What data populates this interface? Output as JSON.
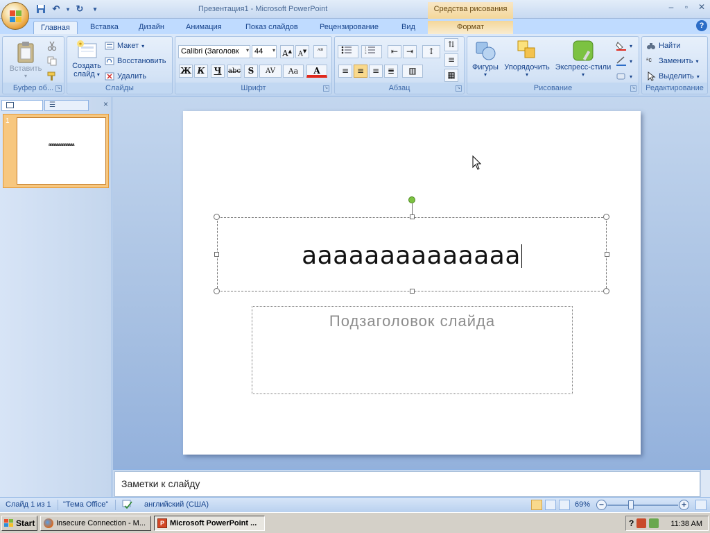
{
  "window": {
    "title": "Презентация1 - Microsoft PowerPoint",
    "context_tab_title": "Средства рисования"
  },
  "tabs": [
    {
      "label": "Главная",
      "active": true
    },
    {
      "label": "Вставка"
    },
    {
      "label": "Дизайн"
    },
    {
      "label": "Анимация"
    },
    {
      "label": "Показ слайдов"
    },
    {
      "label": "Рецензирование"
    },
    {
      "label": "Вид"
    },
    {
      "label": "Формат",
      "context": true
    }
  ],
  "ribbon": {
    "clipboard": {
      "label": "Буфер об...",
      "paste": "Вставить"
    },
    "slides": {
      "label": "Слайды",
      "new_slide_line1": "Создать",
      "new_slide_line2": "слайд",
      "layout": "Макет",
      "reset": "Восстановить",
      "delete": "Удалить"
    },
    "font": {
      "label": "Шрифт",
      "font_name": "Calibri (Заголовк",
      "font_size": "44",
      "bold": "Ж",
      "italic": "К",
      "underline": "Ч",
      "strike": "abc",
      "shadow": "S",
      "spacing": "AV",
      "case": "Aa",
      "color": "A"
    },
    "paragraph": {
      "label": "Абзац"
    },
    "drawing": {
      "label": "Рисование",
      "shapes": "Фигуры",
      "arrange": "Упорядочить",
      "quick_styles": "Экспресс-стили"
    },
    "editing": {
      "label": "Редактирование",
      "find": "Найти",
      "replace": "Заменить",
      "select": "Выделить"
    }
  },
  "slide_panel": {
    "slide_number": "1",
    "thumb_text": "ааааааааааааа"
  },
  "slide": {
    "title": "аааааааааааааа",
    "subtitle_placeholder": "Подзаголовок слайда"
  },
  "notes": {
    "placeholder": "Заметки к слайду"
  },
  "status": {
    "slide_info": "Слайд 1 из 1",
    "theme": "\"Тема Office\"",
    "language": "английский (США)",
    "zoom": "69%"
  },
  "taskbar": {
    "start": "Start",
    "tasks": [
      {
        "label": "Insecure Connection - M...",
        "active": false
      },
      {
        "label": "Microsoft PowerPoint ...",
        "active": true
      }
    ],
    "clock": "11:38 AM"
  },
  "colors": {
    "accent": "#15428b",
    "ribbon_bg": "#dbe8f9",
    "context_tab": "#f4d79a",
    "selected_thumb": "#f7c77f",
    "font_color_bar": "#e0281c"
  }
}
